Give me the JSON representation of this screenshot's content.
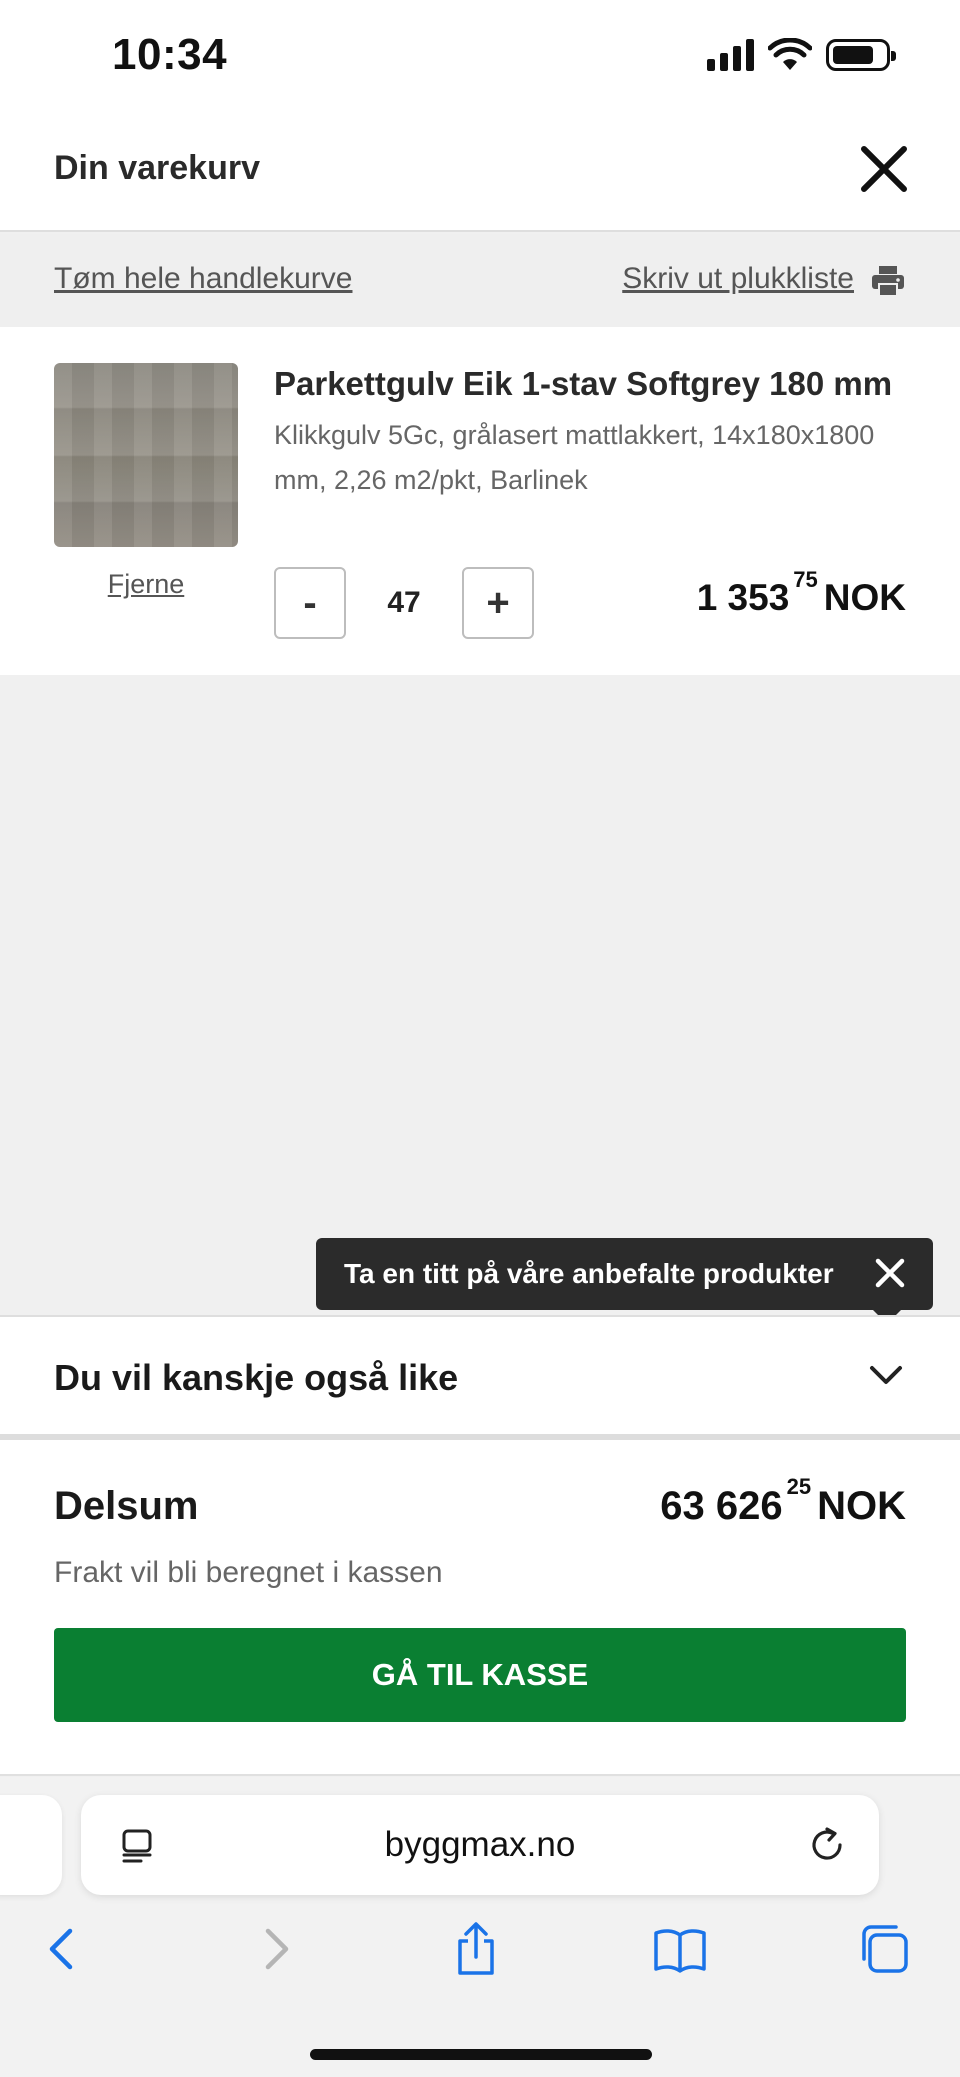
{
  "status_bar": {
    "time": "10:34"
  },
  "header": {
    "title": "Din varekurv"
  },
  "actions": {
    "empty_cart": "Tøm hele handlekurve",
    "print_picklist": "Skriv ut plukkliste"
  },
  "cart_item": {
    "name": "Parkettgulv Eik 1-stav Softgrey 180 mm",
    "description": "Klikkgulv 5Gc, grålasert mattlakkert, 14x180x1800 mm, 2,26 m2/pkt, Barlinek",
    "remove_label": "Fjerne",
    "decrement_label": "-",
    "increment_label": "+",
    "quantity": "47",
    "price_main": "1 353",
    "price_cents": "75",
    "currency": "NOK"
  },
  "tooltip": {
    "text": "Ta en titt på våre anbefalte produkter"
  },
  "recommendations": {
    "title": "Du vil kanskje også like"
  },
  "summary": {
    "label": "Delsum",
    "price_main": "63 626",
    "price_cents": "25",
    "currency": "NOK",
    "shipping_note": "Frakt vil bli beregnet i kassen",
    "checkout_label": "GÅ TIL KASSE"
  },
  "browser": {
    "url": "byggmax.no"
  },
  "colors": {
    "checkout_green": "#0a7f32",
    "tooltip_bg": "#2b2b2b",
    "safari_blue": "#1a73e8"
  }
}
